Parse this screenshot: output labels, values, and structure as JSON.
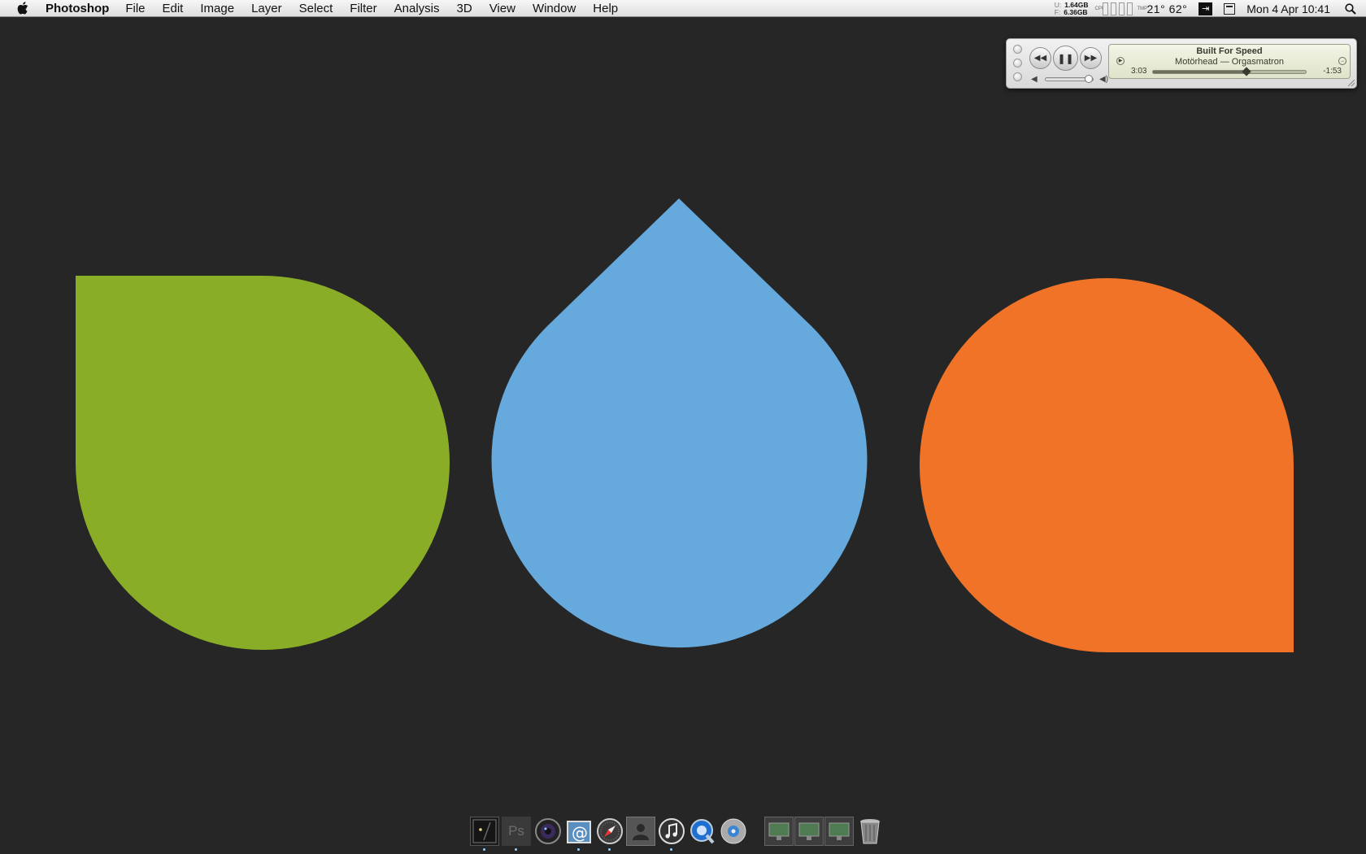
{
  "menubar": {
    "app_name": "Photoshop",
    "menus": [
      "File",
      "Edit",
      "Image",
      "Layer",
      "Select",
      "Filter",
      "Analysis",
      "3D",
      "View",
      "Window",
      "Help"
    ],
    "disk": {
      "used_label": "U:",
      "used": "1.64GB",
      "free_label": "F:",
      "free": "6.36GB"
    },
    "meter_label": "CPU",
    "temp_label": "TMP",
    "temperature": "21° 62°",
    "datetime": "Mon 4 Apr  10:41"
  },
  "colors": {
    "background": "#262626",
    "green_shape": "#8aad28",
    "blue_shape": "#66a9dc",
    "orange_shape": "#f07327"
  },
  "player": {
    "track": "Built For Speed",
    "artist_album": "Motörhead — Orgasmatron",
    "elapsed": "3:03",
    "remaining": "-1:53",
    "progress": 0.61,
    "volume": 0.9,
    "buttons": [
      "rewind-icon",
      "pause-icon",
      "fast-forward-icon"
    ]
  },
  "dock": {
    "apps": [
      "finder",
      "photoshop",
      "aperture",
      "mail",
      "safari",
      "address-book",
      "itunes",
      "quicktime",
      "dvd-player",
      "stack-1",
      "stack-2",
      "stack-3",
      "trash"
    ],
    "photoshop_label": "Ps"
  }
}
